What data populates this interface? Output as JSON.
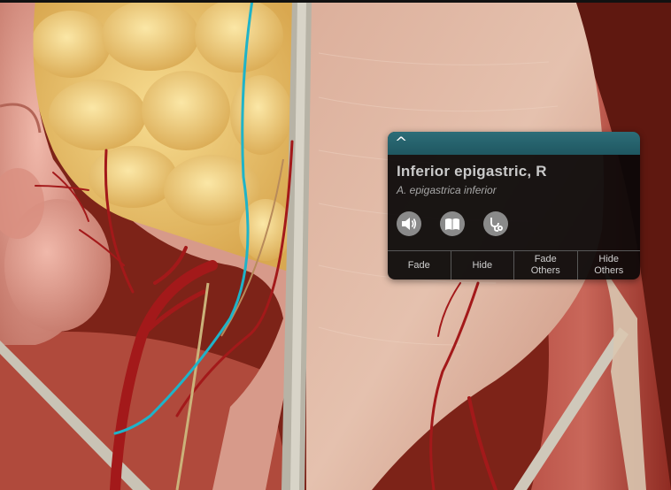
{
  "info_panel": {
    "collapse_glyph": "^",
    "title": "Inferior epigastric, R",
    "latin_name": "A. epigastrica inferior",
    "icons": [
      "speaker-icon",
      "book-icon",
      "stethoscope-icon"
    ],
    "actions": {
      "fade": "Fade",
      "hide": "Hide",
      "fade_others": "Fade\nOthers",
      "hide_others": "Hide\nOthers"
    }
  },
  "colors": {
    "panel_header": "#246370",
    "highlighted_vessel": "#1fb3c8",
    "artery": "#a3191a"
  }
}
